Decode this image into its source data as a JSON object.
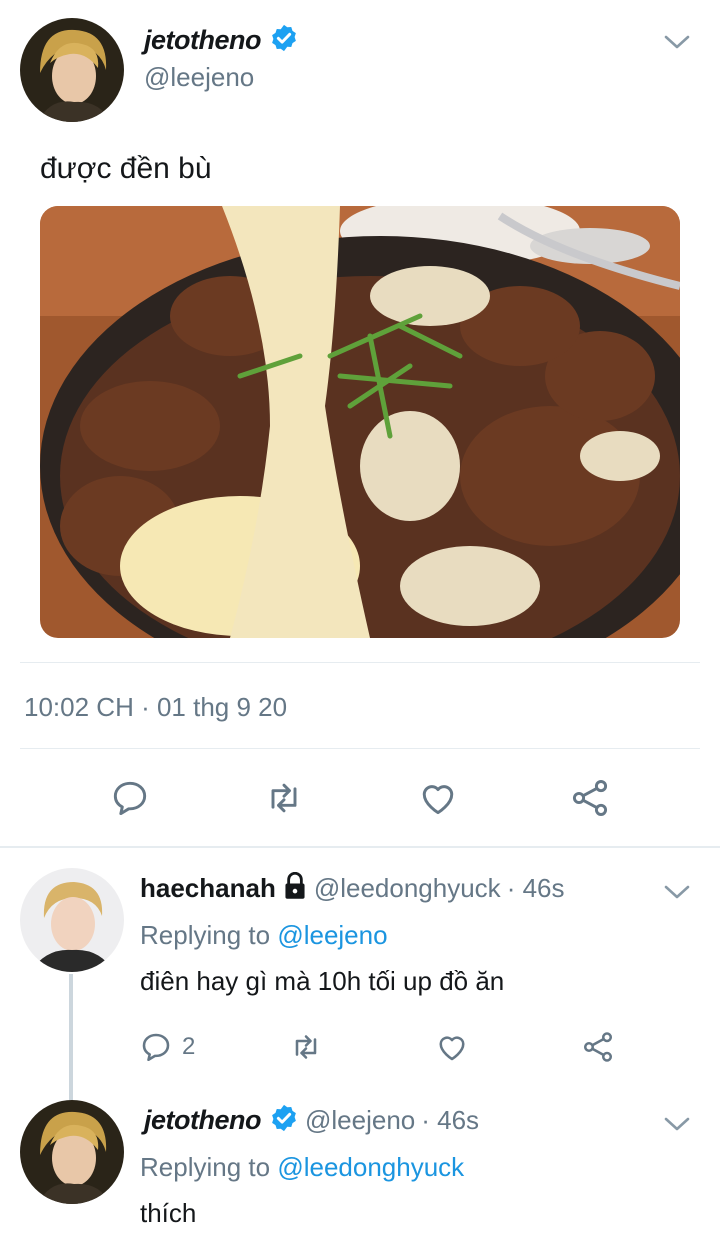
{
  "main_tweet": {
    "display_name": "jetotheno",
    "handle": "@leejeno",
    "text": "được đền bù",
    "timestamp": "10:02 CH · 01 thg 9 20"
  },
  "replies": [
    {
      "display_name": "haechanah",
      "handle": "@leedonghyuck",
      "age": "· 46s",
      "replying_label": "Replying to",
      "replying_to": "@leejeno",
      "text": "điên hay gì mà 10h tối up đồ ăn",
      "reply_count": "2"
    },
    {
      "display_name": "jetotheno",
      "handle": "@leejeno",
      "age": "· 46s",
      "replying_label": "Replying to",
      "replying_to": "@leedonghyuck",
      "text": "thích"
    }
  ],
  "colors": {
    "accent": "#1b95e0",
    "icon_grey": "#657786",
    "divider": "#e6ecf0"
  },
  "icons": [
    "verified-badge-icon",
    "chevron-down-icon",
    "reply-icon",
    "retweet-icon",
    "like-icon",
    "share-icon",
    "lock-icon"
  ]
}
